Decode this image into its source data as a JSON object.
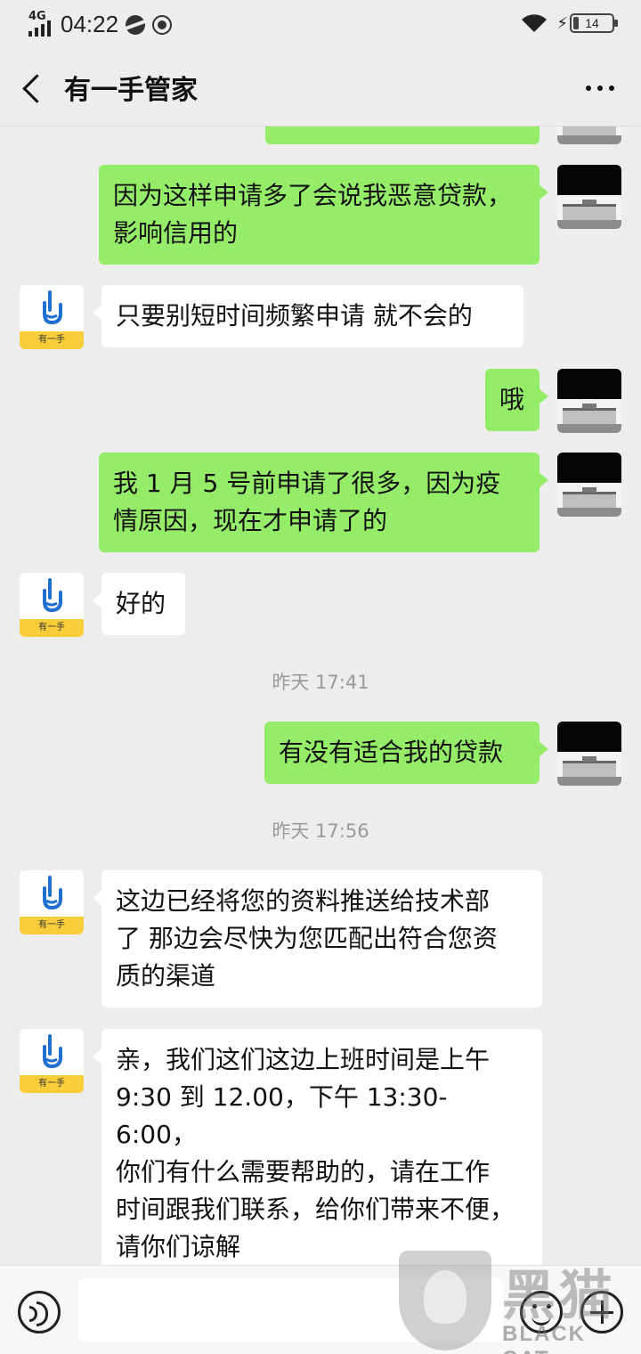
{
  "status_bar": {
    "network": "4G",
    "time": "04:22",
    "battery": "14",
    "battery_fraction": 0.14
  },
  "header": {
    "title": "有一手管家"
  },
  "bot": {
    "avatar_label": "有一手"
  },
  "messages": [
    {
      "side": "sent",
      "lines": [
        "因为这样申请多了会说我恶意贷款，",
        "影响信用的"
      ]
    },
    {
      "side": "recv",
      "lines": [
        "只要别短时间频繁申请 就不会的"
      ]
    },
    {
      "side": "sent",
      "lines": [
        "哦"
      ]
    },
    {
      "side": "sent",
      "lines": [
        "我 1 月 5 号前申请了很多，因为疫",
        "情原因，现在才申请了的"
      ]
    },
    {
      "side": "recv",
      "lines": [
        "好的"
      ]
    },
    {
      "side": "sent",
      "lines": [
        "有没有适合我的贷款"
      ]
    },
    {
      "side": "recv",
      "lines": [
        "这边已经将您的资料推送给技术部",
        "了 那边会尽快为您匹配出符合您资",
        "质的渠道"
      ]
    },
    {
      "side": "recv",
      "lines": [
        "亲，我们这们这边上班时间是上午",
        "9:30 到 12.00，下午 13:30-6:00，",
        "你们有什么需要帮助的，请在工作",
        "时间跟我们联系，给你们带来不便，",
        "请你们谅解"
      ]
    }
  ],
  "timestamps": [
    "昨天 17:41",
    "昨天 17:56"
  ],
  "input": {
    "value": "",
    "placeholder": ""
  },
  "watermark": {
    "cn": "黑猫",
    "en": "BLACK CAT"
  },
  "colors": {
    "sent_bubble": "#95ec69",
    "recv_bubble": "#ffffff",
    "background": "#ededed",
    "bot_band": "#f7cd3a"
  },
  "icons": [
    "back-icon",
    "more-icon",
    "voice-icon",
    "emoji-icon",
    "plus-icon",
    "wifi-icon",
    "battery-icon"
  ]
}
